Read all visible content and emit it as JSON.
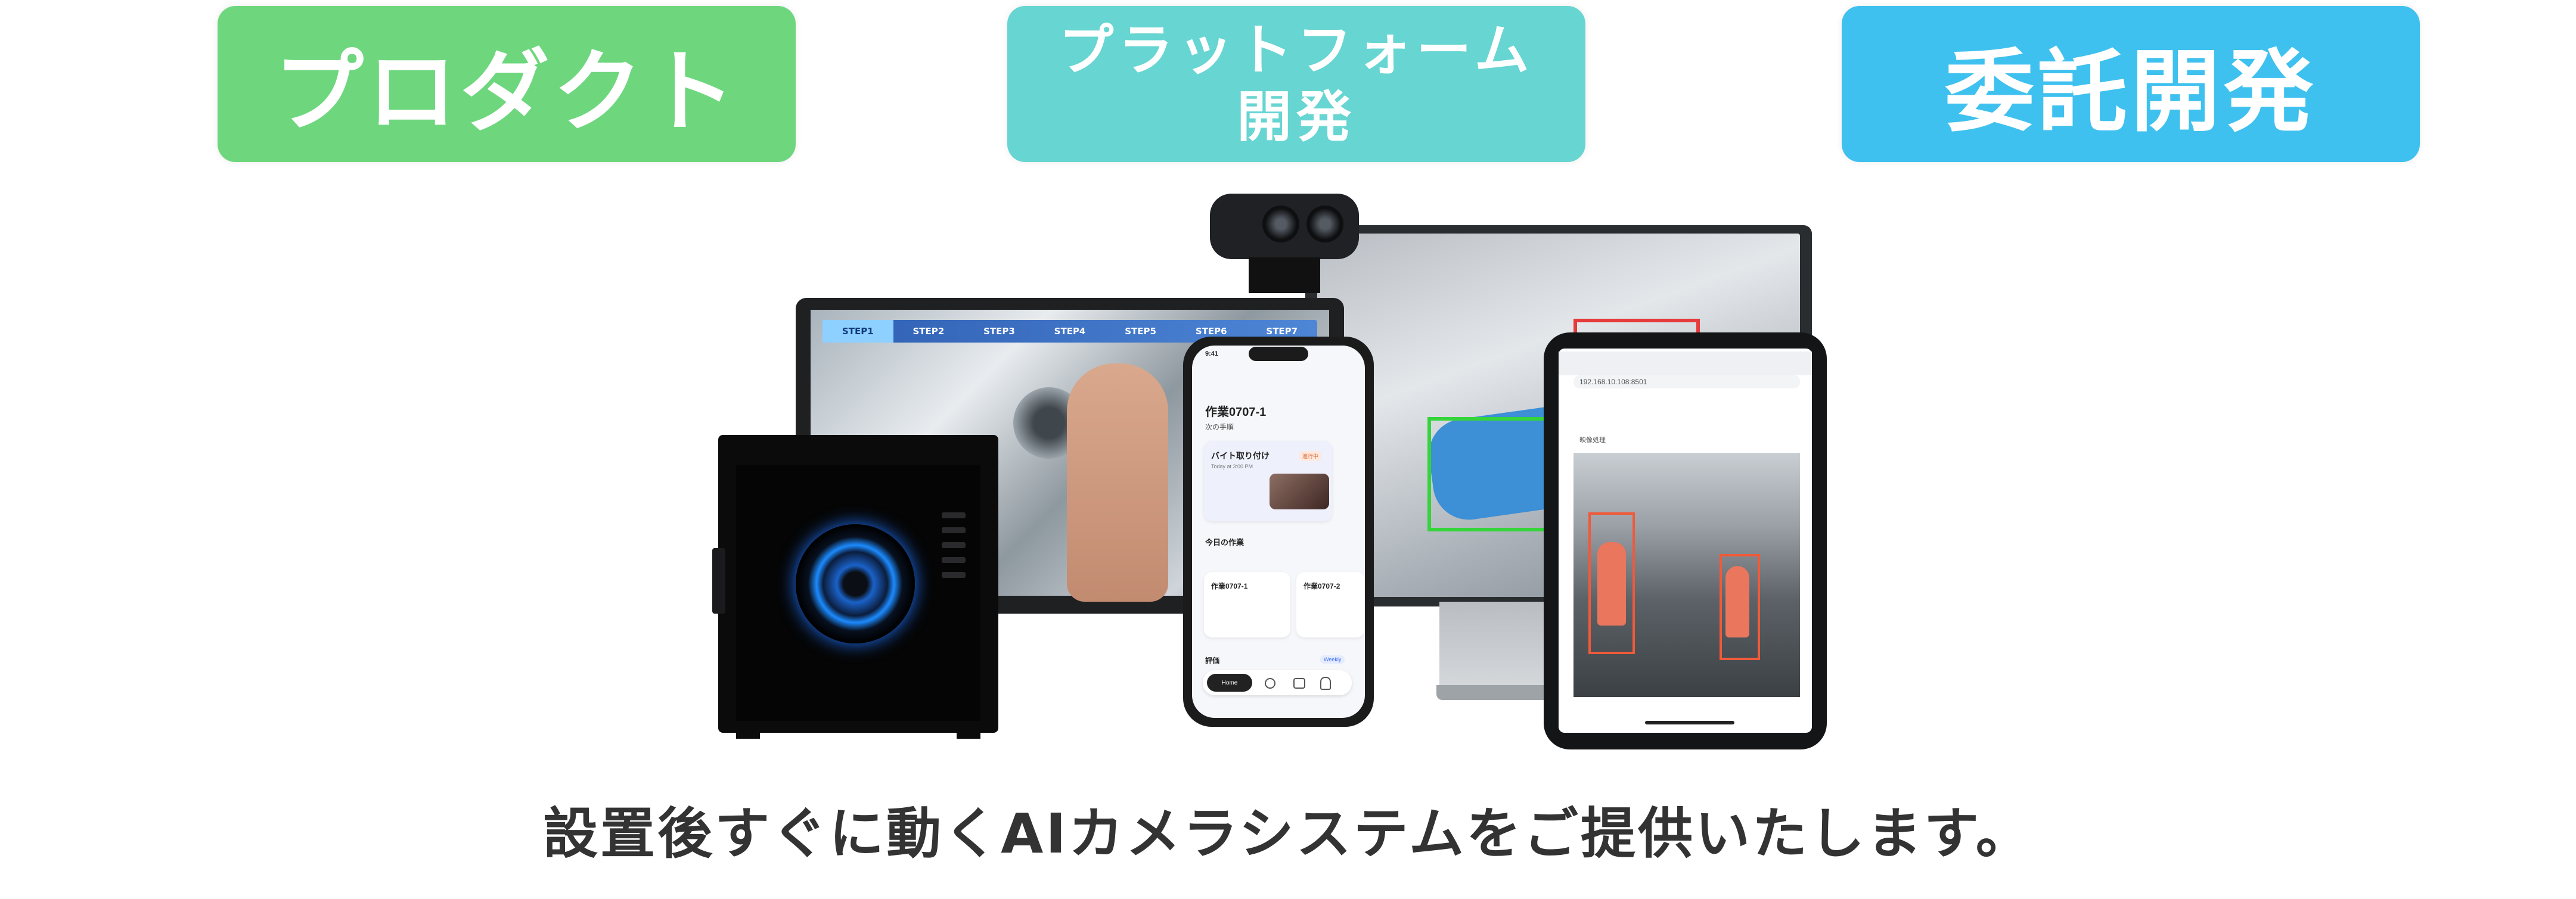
{
  "top_pills": {
    "product": "プロダクト",
    "platform_line1": "プラットフォーム",
    "platform_line2": "開発",
    "contract": "委託開発"
  },
  "tablet": {
    "steps": [
      "STEP1",
      "STEP2",
      "STEP3",
      "STEP4",
      "STEP5",
      "STEP6",
      "STEP7"
    ]
  },
  "phone": {
    "time": "9:41",
    "title": "作業0707-1",
    "next_steps_label": "次の手順",
    "card_title": "バイト取り付け",
    "card_badge": "進行中",
    "card_time": "Today at 3:00 PM",
    "today_label": "今日の作業",
    "task1": "作業0707-1",
    "task2": "作業0707-2",
    "eval_label": "評価",
    "weekly": "Weekly",
    "home": "Home"
  },
  "ipad": {
    "address": "192.168.10.108:8501",
    "section_label": "映像処理"
  },
  "caption": "設置後すぐに動くAIカメラシステムをご提供いたします。",
  "colors": {
    "product": "#6ed77e",
    "platform": "#67d5d2",
    "contract": "#3fc1ef"
  }
}
